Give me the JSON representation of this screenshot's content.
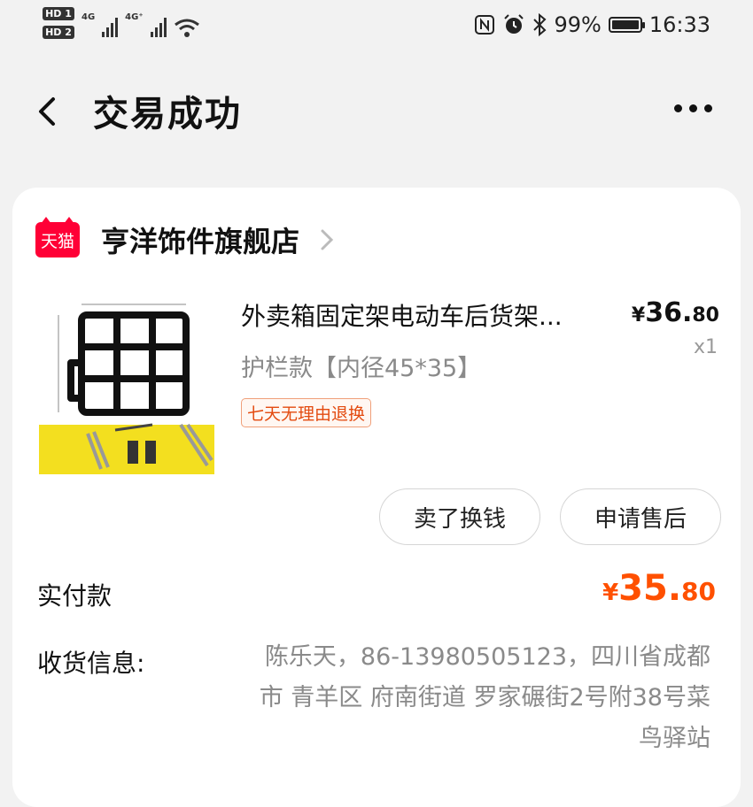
{
  "status_bar": {
    "hd1": "HD 1",
    "hd2": "HD 2",
    "net1": "4G",
    "net2": "4G⁺",
    "battery_percent": "99%",
    "battery_level": 0.99,
    "time": "16:33",
    "icons": [
      "nfc-icon",
      "alarm-icon",
      "bluetooth-icon",
      "battery-icon",
      "wifi-icon",
      "signal-icon"
    ]
  },
  "header": {
    "title": "交易成功"
  },
  "order": {
    "store": {
      "badge": "天猫",
      "name": "亨洋饰件旗舰店"
    },
    "item": {
      "name": "外卖箱固定架电动车后货架...",
      "spec": "护栏款【内径45*35】",
      "tag": "七天无理由退换",
      "price_symbol": "¥",
      "price_int": "36.",
      "price_dec": "80",
      "quantity": "x1"
    },
    "buttons": {
      "sell": "卖了换钱",
      "after_sales": "申请售后"
    },
    "payment": {
      "label": "实付款",
      "symbol": "¥",
      "amount_int": "35.",
      "amount_dec": "80"
    },
    "shipping": {
      "label": "收货信息:",
      "address": "陈乐天，86-13980505123，四川省成都市 青羊区 府南街道 罗家碾街2号附38号菜鸟驿站"
    }
  },
  "colors": {
    "accent": "#ff5000",
    "tmall_red": "#ff0036",
    "tag_orange": "#e34b10"
  }
}
